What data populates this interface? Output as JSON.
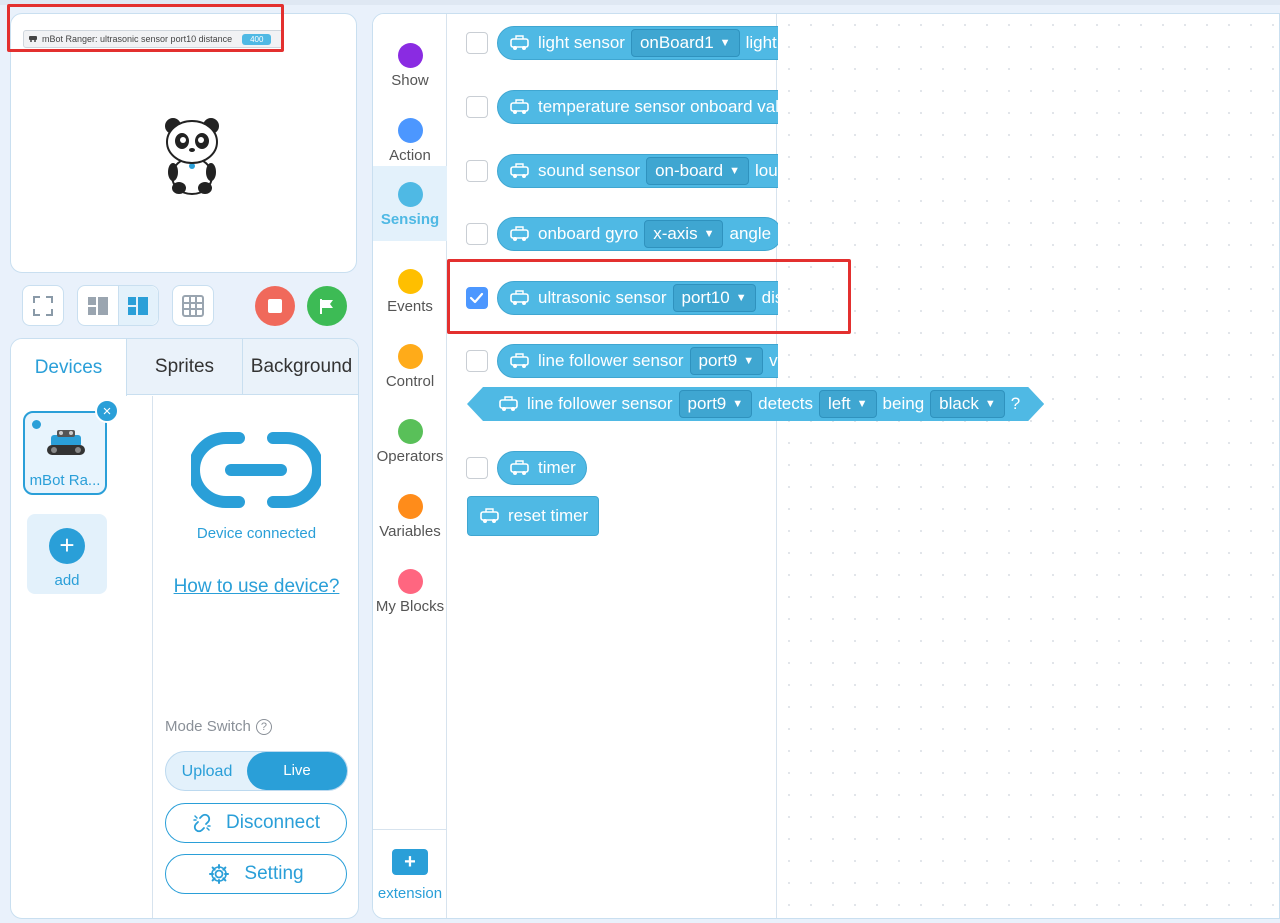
{
  "stage": {
    "monitor_label": "mBot Ranger: ultrasonic sensor port10 distance",
    "monitor_value": "400"
  },
  "tabs": {
    "devices": "Devices",
    "sprites": "Sprites",
    "background": "Background"
  },
  "devices": {
    "device_name": "mBot Ra...",
    "add_label": "add",
    "close_symbol": "×",
    "add_symbol": "+"
  },
  "device_info": {
    "status": "Device connected",
    "how_to": "How to use device?",
    "mode_switch_label": "Mode Switch",
    "mode_help": "?",
    "upload": "Upload",
    "live": "Live",
    "disconnect": "Disconnect",
    "setting": "Setting"
  },
  "categories": [
    {
      "label": "Show",
      "color": "#8a2be2"
    },
    {
      "label": "Action",
      "color": "#4c97ff"
    },
    {
      "label": "Sensing",
      "color": "#4fb9e4"
    },
    {
      "label": "Events",
      "color": "#ffbf00"
    },
    {
      "label": "Control",
      "color": "#ffab19"
    },
    {
      "label": "Operators",
      "color": "#59c059"
    },
    {
      "label": "Variables",
      "color": "#ff8c1a"
    },
    {
      "label": "My Blocks",
      "color": "#ff6680"
    }
  ],
  "extension_label": "extension",
  "extension_symbol": "+",
  "blocks": {
    "light": {
      "text1": "light sensor",
      "dropdown": "onBoard1",
      "text2": "light intensity"
    },
    "temperature": {
      "text1": "temperature sensor onboard value ℃"
    },
    "sound": {
      "text1": "sound sensor",
      "dropdown": "on-board",
      "text2": "loudness"
    },
    "gyro": {
      "text1": "onboard gyro",
      "dropdown": "x-axis",
      "text2": "angle"
    },
    "ultrasonic": {
      "text1": "ultrasonic sensor",
      "dropdown": "port10",
      "text2": "distance"
    },
    "line_value": {
      "text1": "line follower sensor",
      "dropdown": "port9",
      "text2": "value"
    },
    "line_detect": {
      "text1": "line follower sensor",
      "dropdown1": "port9",
      "text2": "detects",
      "dropdown2": "left",
      "text3": "being",
      "dropdown3": "black",
      "text4": "?"
    },
    "timer": {
      "text1": "timer"
    },
    "reset_timer": {
      "text1": "reset timer"
    }
  },
  "dropdown_caret": "▼"
}
